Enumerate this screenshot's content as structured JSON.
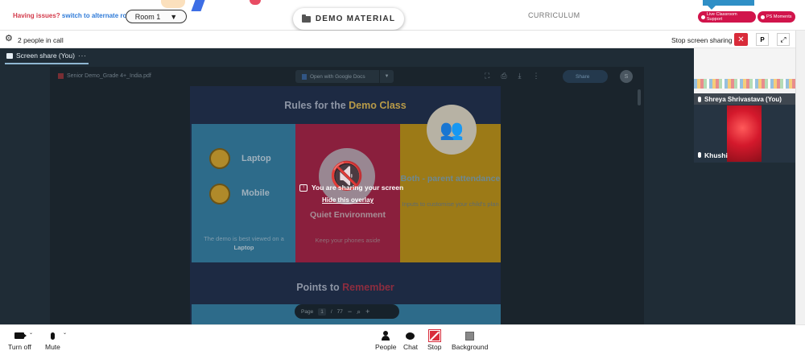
{
  "topbar": {
    "issues_text": "Having issues?",
    "switch_text": "switch to alternate room",
    "room_label": "Room 1",
    "demo_material": "DEMO MATERIAL",
    "curriculum": "CURRICULUM",
    "support_label": "Live Classroom Support",
    "ps_label": "PS Moments"
  },
  "callbar": {
    "people_count": "2 people in call",
    "stop_sharing": "Stop screen sharing",
    "p_label": "P"
  },
  "tab": {
    "label": "Screen share (You)",
    "menu": "···"
  },
  "pdf": {
    "filename": "Senior Demo_Grade 4+_India.pdf",
    "open_with": "Open with Google Docs",
    "share": "Share",
    "avatar": "S",
    "page_label": "Page",
    "page_current": "1",
    "page_sep": "/",
    "page_total": "77"
  },
  "slide": {
    "title_part1": "Rules for the ",
    "title_part2": "Demo Class",
    "laptop": "Laptop",
    "mobile": "Mobile",
    "blue_text1": "The demo is best viewed on a ",
    "blue_text2": "Laptop",
    "quiet_title": "Quiet Environment",
    "quiet_sub": "Keep your phones aside",
    "both_title": "Both - parent attendance",
    "both_sub": "Inputs to customise your child's plan",
    "points_part1": "Points to ",
    "points_part2": "Remember"
  },
  "overlay": {
    "sharing": "You are sharing your screen",
    "hide": "Hide this overlay"
  },
  "participants": [
    {
      "name": "Shreya Shrivastava (You)"
    },
    {
      "name": "Khushi"
    }
  ],
  "toolbar": {
    "turn_off": "Turn off",
    "mute": "Mute",
    "people": "People",
    "chat": "Chat",
    "stop": "Stop",
    "background": "Background"
  },
  "colors": {
    "danger": "#d92b3a",
    "brand_pink": "#d1144b",
    "dark_bg": "#1f2c36"
  }
}
